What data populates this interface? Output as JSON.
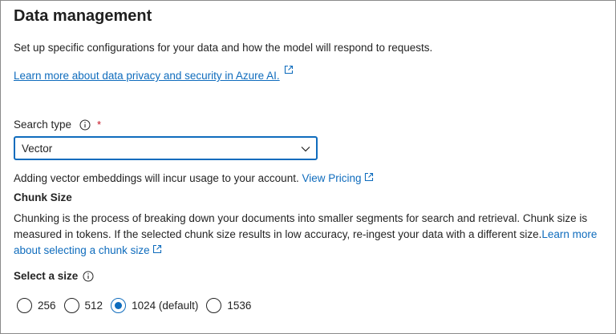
{
  "header": {
    "title": "Data management"
  },
  "intro": {
    "description": "Set up specific configurations for your data and how the model will respond to requests.",
    "privacy_link": "Learn more about data privacy and security in Azure AI."
  },
  "search_type": {
    "label": "Search type",
    "required_mark": "*",
    "selected": "Vector"
  },
  "pricing": {
    "text": "Adding vector embeddings will incur usage to your account.",
    "link": "View Pricing"
  },
  "chunk": {
    "heading": "Chunk Size",
    "description": "Chunking is the process of breaking down your documents into smaller segments for search and retrieval. Chunk size is measured in tokens. If the selected chunk size results in low accuracy, re-ingest your data with a different size.",
    "link": "Learn more about selecting a chunk size"
  },
  "size": {
    "label": "Select a size",
    "options": [
      {
        "label": "256",
        "selected": false
      },
      {
        "label": "512",
        "selected": false
      },
      {
        "label": "1024 (default)",
        "selected": true
      },
      {
        "label": "1536",
        "selected": false
      }
    ]
  },
  "colors": {
    "accent": "#0f6cbd",
    "required": "#c50f1f",
    "text": "#242424"
  }
}
